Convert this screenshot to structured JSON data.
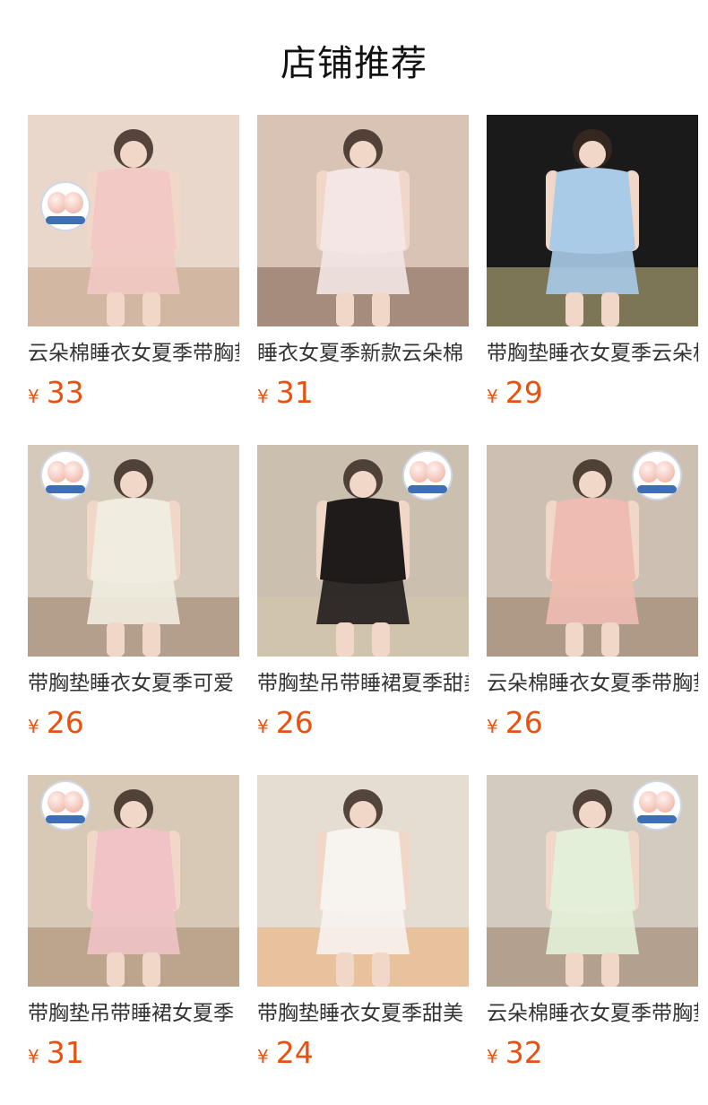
{
  "title": "店铺推荐",
  "currency_symbol": "¥",
  "products": [
    {
      "name": "云朵棉睡衣女夏季带胸垫",
      "price": "33",
      "colors": [
        "#e9d7cc",
        "#f2c9c4",
        "#b69170"
      ],
      "badge": true
    },
    {
      "name": "睡衣女夏季新款云朵棉",
      "price": "31",
      "colors": [
        "#d8c3b4",
        "#f3e6e4",
        "#6b4a3a"
      ],
      "badge": false
    },
    {
      "name": "带胸垫睡衣女夏季云朵棉",
      "price": "29",
      "colors": [
        "#1a1a1a",
        "#a9cbe8",
        "#f3e7a0"
      ],
      "badge": false
    },
    {
      "name": "带胸垫睡衣女夏季可爱",
      "price": "26",
      "colors": [
        "#d5c9bc",
        "#f1ece0",
        "#8b6a52"
      ],
      "badge": true
    },
    {
      "name": "带胸垫吊带睡裙夏季甜美",
      "price": "26",
      "colors": [
        "#cbbfb0",
        "#1f1b1b",
        "#d8c9a8"
      ],
      "badge": true
    },
    {
      "name": "云朵棉睡衣女夏季带胸垫",
      "price": "26",
      "colors": [
        "#cdbfb1",
        "#eebcb0",
        "#8c6b54"
      ],
      "badge": true
    },
    {
      "name": "带胸垫吊带睡裙女夏季",
      "price": "31",
      "colors": [
        "#d8c8b6",
        "#f1c3c6",
        "#9a7a5c"
      ],
      "badge": true
    },
    {
      "name": "带胸垫睡衣女夏季甜美",
      "price": "24",
      "colors": [
        "#e6ddd2",
        "#f7f3ee",
        "#e8a25a"
      ],
      "badge": false
    },
    {
      "name": "云朵棉睡衣女夏季带胸垫",
      "price": "32",
      "colors": [
        "#d3cbc0",
        "#e3efd8",
        "#8b6d52"
      ],
      "badge": true
    }
  ]
}
